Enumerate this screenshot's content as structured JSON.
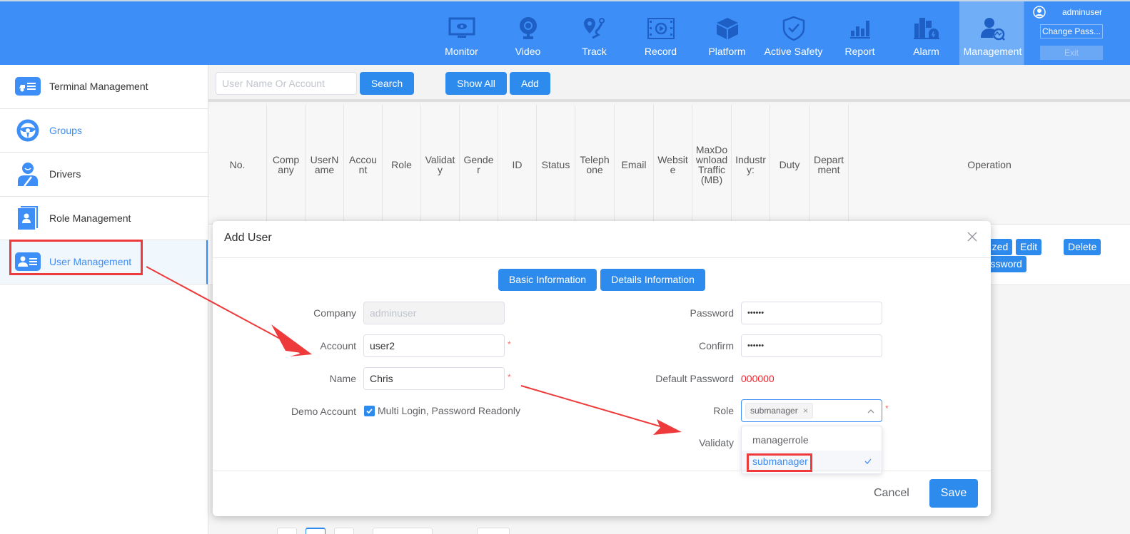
{
  "header": {
    "nav": [
      {
        "label": "Monitor",
        "icon": "monitor-icon"
      },
      {
        "label": "Video",
        "icon": "webcam-icon"
      },
      {
        "label": "Track",
        "icon": "track-route-icon"
      },
      {
        "label": "Record",
        "icon": "film-record-icon"
      },
      {
        "label": "Platform",
        "icon": "cube-icon"
      },
      {
        "label": "Active Safety",
        "icon": "shield-check-icon"
      },
      {
        "label": "Report",
        "icon": "bar-chart-icon"
      },
      {
        "label": "Alarm",
        "icon": "alarm-siren-icon"
      },
      {
        "label": "Management",
        "icon": "user-gear-icon",
        "active": true
      }
    ],
    "user": {
      "name": "adminuser",
      "change_password_label": "Change Pass...",
      "exit_label": "Exit"
    }
  },
  "sidebar": {
    "items": [
      {
        "label": "Terminal Management",
        "icon": "truck-list-icon"
      },
      {
        "label": "Groups",
        "icon": "steering-wheel-icon"
      },
      {
        "label": "Drivers",
        "icon": "driver-icon"
      },
      {
        "label": "Role Management",
        "icon": "contact-book-icon"
      },
      {
        "label": "User Management",
        "icon": "user-card-icon",
        "active": true
      }
    ]
  },
  "toolbar": {
    "search_placeholder": "User Name Or Account",
    "search_value": "",
    "search_label": "Search",
    "show_all_label": "Show All",
    "add_label": "Add"
  },
  "table": {
    "columns": [
      "No.",
      "Company",
      "UserName",
      "Account",
      "Role",
      "Validaty",
      "Gender",
      "ID",
      "Status",
      "Telephone",
      "Email",
      "Website",
      "MaxDownloadTraffic(MB)",
      "Industry:",
      "Duty",
      "Department",
      "Operation"
    ],
    "row_operations": [
      "...zed",
      "Edit",
      "Delete",
      "...assword"
    ]
  },
  "modal": {
    "title": "Add User",
    "tabs": [
      "Basic Information",
      "Details Information"
    ],
    "left_fields": {
      "company_label": "Company",
      "company_value": "adminuser",
      "account_label": "Account",
      "account_value": "user2",
      "name_label": "Name",
      "name_value": "Chris",
      "demo_label": "Demo Account",
      "demo_checked": true,
      "demo_text": "Multi Login, Password Readonly"
    },
    "right_fields": {
      "password_label": "Password",
      "password_value": "••••••",
      "confirm_label": "Confirm",
      "confirm_value": "••••••",
      "default_password_label": "Default Password",
      "default_password_value": "000000",
      "role_label": "Role",
      "role_selected": "submanager",
      "validaty_label": "Validaty"
    },
    "required_mark": "*",
    "role_options": [
      {
        "label": "managerrole",
        "selected": false
      },
      {
        "label": "submanager",
        "selected": true
      }
    ],
    "cancel_label": "Cancel",
    "save_label": "Save"
  },
  "colors": {
    "primary": "#2e8bee",
    "header_bg": "#3d8ef6",
    "annotation_red": "#ee3a3a",
    "required_red": "#f56c6c"
  }
}
